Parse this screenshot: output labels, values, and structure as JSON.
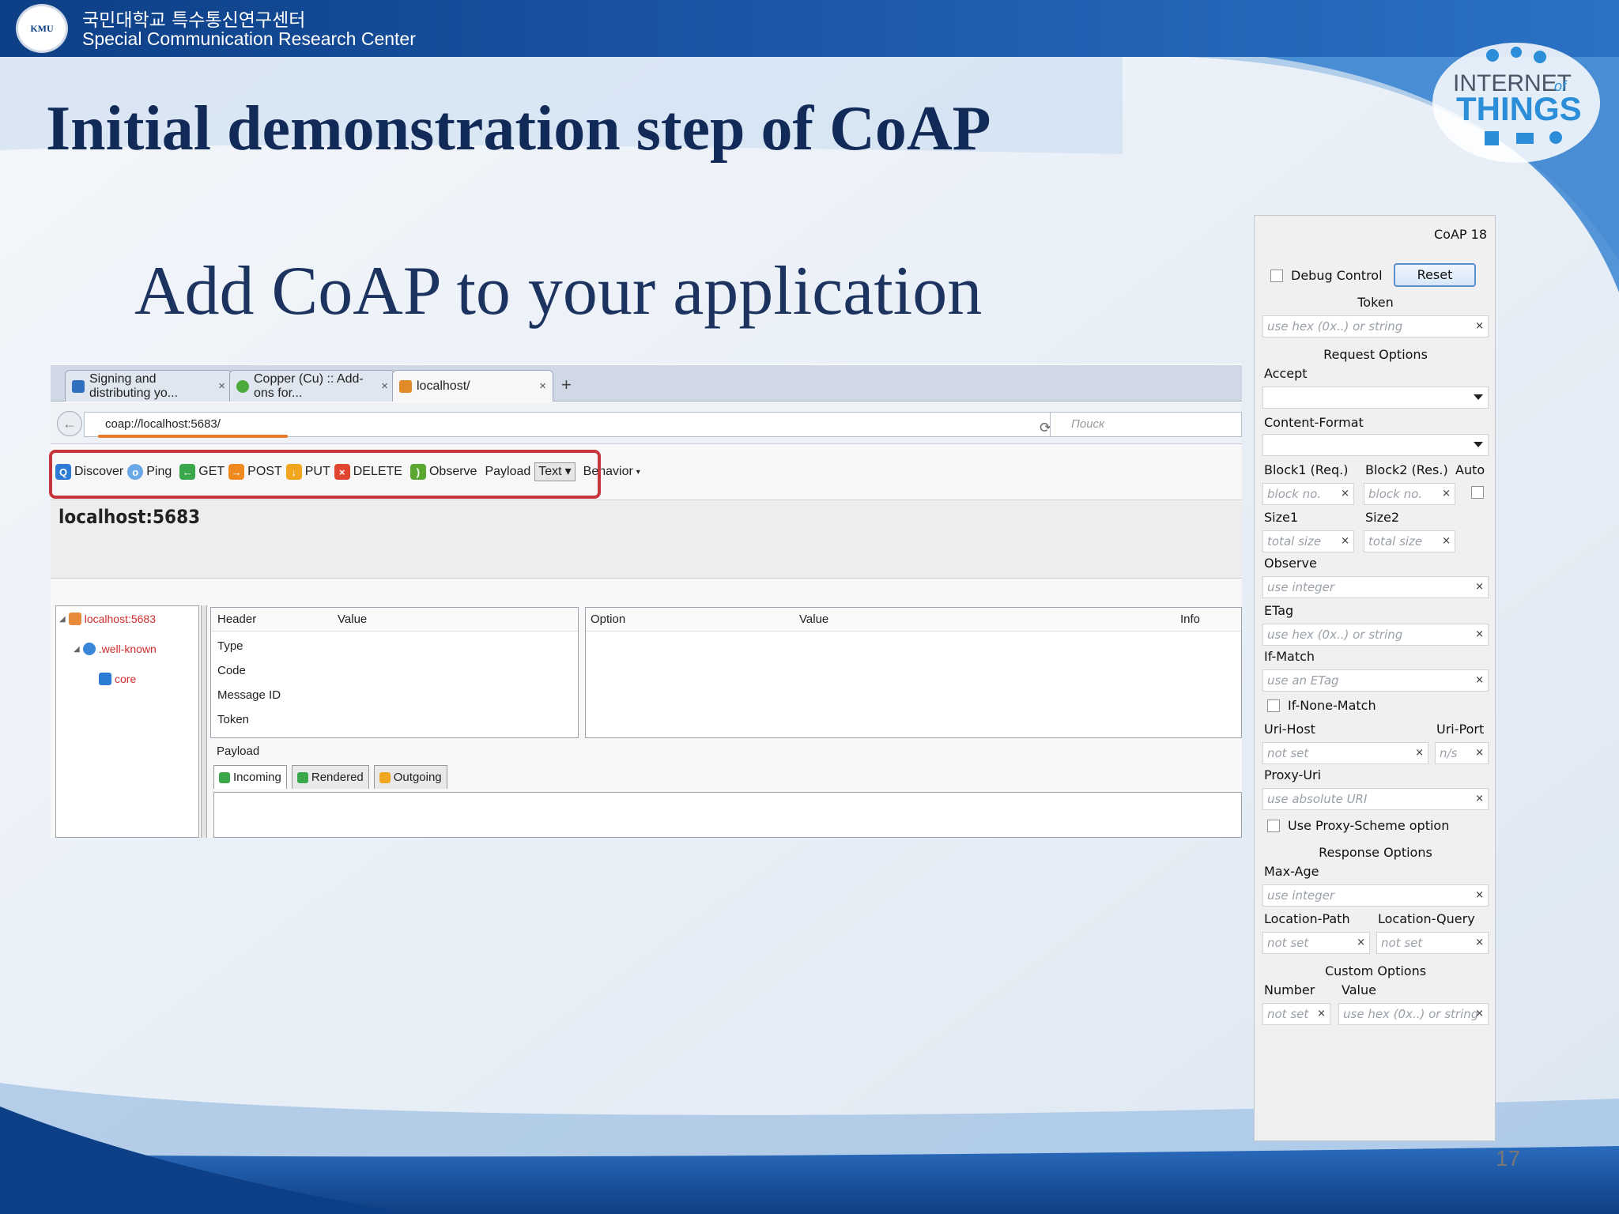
{
  "header": {
    "logo_text": "KMU",
    "title_ko": "국민대학교 특수통신연구센터",
    "title_en": "Special Communication Research Center"
  },
  "slide": {
    "title": "Initial demonstration step of CoAP",
    "subtitle": "Add CoAP to your application",
    "page_number": "17",
    "iot_logo": {
      "line1": "INTERNET",
      "of": "of",
      "line2": "THINGS"
    }
  },
  "browser": {
    "tabs": [
      {
        "label": "Signing and distributing yo...",
        "close": "×",
        "icon_color": "#2f6fc0"
      },
      {
        "label": "Copper (Cu) :: Add-ons for...",
        "close": "×",
        "icon_color": "#4caa3d"
      },
      {
        "label": "localhost/",
        "close": "×",
        "icon_color": "#e08a2a"
      }
    ],
    "new_tab": "+",
    "url": "coap://localhost:5683/",
    "search_placeholder": "Поиск",
    "toolbar": {
      "discover": "Discover",
      "ping": "Ping",
      "get": "GET",
      "post": "POST",
      "put": "PUT",
      "delete": "DELETE",
      "observe": "Observe",
      "payload": "Payload",
      "payload_type": "Text",
      "behavior": "Behavior"
    },
    "host_heading": "localhost:5683",
    "tree": {
      "root": "localhost:5683",
      "child": ".well-known",
      "leaf": "core"
    },
    "header_table": {
      "col_header": "Header",
      "col_value": "Value",
      "rows": [
        "Type",
        "Code",
        "Message ID",
        "Token"
      ]
    },
    "option_table": {
      "col_option": "Option",
      "col_value": "Value",
      "col_info": "Info"
    },
    "payload_label": "Payload",
    "payload_tabs": [
      "Incoming",
      "Rendered",
      "Outgoing"
    ]
  },
  "panel": {
    "title": "CoAP 18",
    "debug_control": "Debug Control",
    "reset": "Reset",
    "token_label": "Token",
    "token_placeholder": "use hex (0x..) or string",
    "request_options": "Request Options",
    "accept": "Accept",
    "content_format": "Content-Format",
    "block1": "Block1 (Req.)",
    "block2": "Block2 (Res.)",
    "auto": "Auto",
    "block_placeholder": "block no.",
    "size1": "Size1",
    "size2": "Size2",
    "size_placeholder": "total size",
    "observe": "Observe",
    "integer_placeholder": "use integer",
    "etag": "ETag",
    "etag_placeholder": "use hex (0x..) or string",
    "if_match": "If-Match",
    "if_match_placeholder": "use an ETag",
    "if_none_match": "If-None-Match",
    "uri_host": "Uri-Host",
    "uri_port": "Uri-Port",
    "not_set": "not set",
    "ns": "n/s",
    "proxy_uri": "Proxy-Uri",
    "proxy_placeholder": "use absolute URI",
    "proxy_scheme": "Use Proxy-Scheme option",
    "response_options": "Response Options",
    "max_age": "Max-Age",
    "location_path": "Location-Path",
    "location_query": "Location-Query",
    "custom_options": "Custom Options",
    "number": "Number",
    "value": "Value",
    "value_placeholder": "use hex (0x..) or string",
    "clear": "×"
  }
}
